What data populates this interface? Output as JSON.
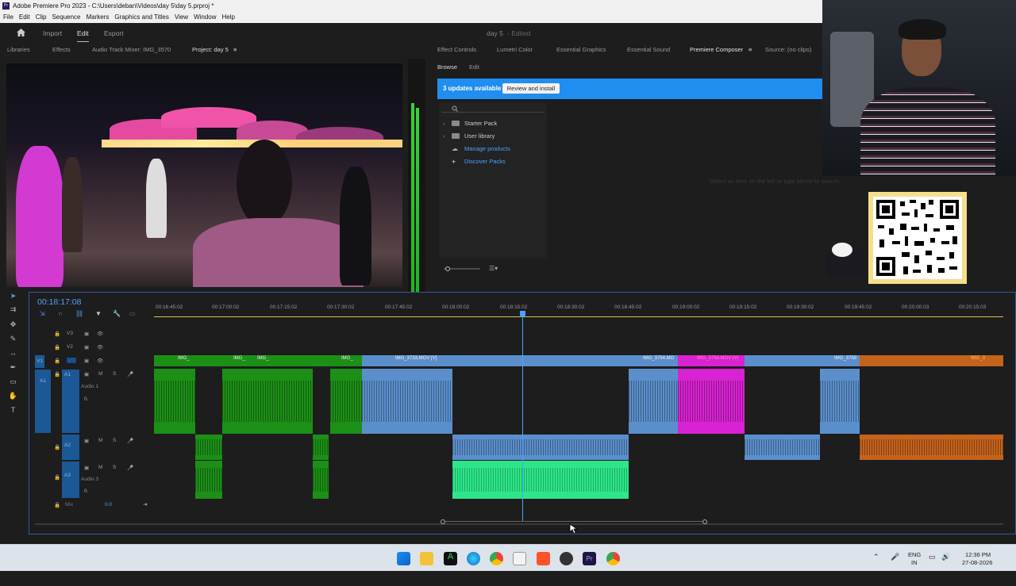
{
  "window": {
    "title": "Adobe Premiere Pro 2023 - C:\\Users\\deban\\Videos\\day 5\\day 5.prproj *",
    "app_icon": "Pr"
  },
  "menu": [
    "File",
    "Edit",
    "Clip",
    "Sequence",
    "Markers",
    "Graphics and Titles",
    "View",
    "Window",
    "Help"
  ],
  "header": {
    "tabs": [
      "Import",
      "Edit",
      "Export"
    ],
    "active_tab": "Edit",
    "project_title": "day 5",
    "status": "- Edited"
  },
  "left_panel_tabs": [
    "Libraries",
    "Effects",
    "Audio Track Mixer: IMG_3570",
    "Project: day 5"
  ],
  "right_panel_tabs": [
    "Effect Controls",
    "Lumetri Color",
    "Essential Graphics",
    "Essential Sound",
    "Premiere Composer",
    "Source: (no clips)"
  ],
  "composer": {
    "subtabs": [
      "Browse",
      "Edit"
    ],
    "update_text": "3 updates available",
    "update_button": "Review and install",
    "tree": [
      {
        "label": "Starter Pack",
        "type": "folder"
      },
      {
        "label": "User library",
        "type": "folder"
      },
      {
        "label": "Manage products",
        "type": "link"
      },
      {
        "label": "Discover Packs",
        "type": "link"
      }
    ],
    "empty_message": "Select an item on the left or type above to search"
  },
  "timeline": {
    "timecode": "00:18:17:08",
    "ruler": [
      "00:16:45:02",
      "00:17:00:02",
      "00:17:15:02",
      "00:17:30:02",
      "00:17:45:02",
      "00:18:00:02",
      "00:18:15:02",
      "00:18:30:02",
      "00:18:45:02",
      "00:19:00:02",
      "00:19:15:02",
      "00:19:30:02",
      "00:19:45:02",
      "00:20:00:03",
      "00:20:15:03"
    ],
    "video_tracks": [
      "V3",
      "V2",
      "V1"
    ],
    "audio_tracks": [
      "A1",
      "A2",
      "A3"
    ],
    "audio1_name": "Audio 1",
    "audio3_name": "Audio 3",
    "vol": "0.",
    "mix_label": "Mix",
    "mix_value": "0.0",
    "clip_labels": [
      "IMG_",
      "IMG_",
      "IMG_",
      "IMG_3733.MOV [V]",
      "IMG_3754.MO",
      "IMG_3758.MOV [V]",
      "IMG_3759",
      "IMG_3"
    ]
  },
  "taskbar": {
    "lang": "ENG",
    "region": "IN",
    "time": "12:36 PM",
    "date": "27-08-2026"
  }
}
